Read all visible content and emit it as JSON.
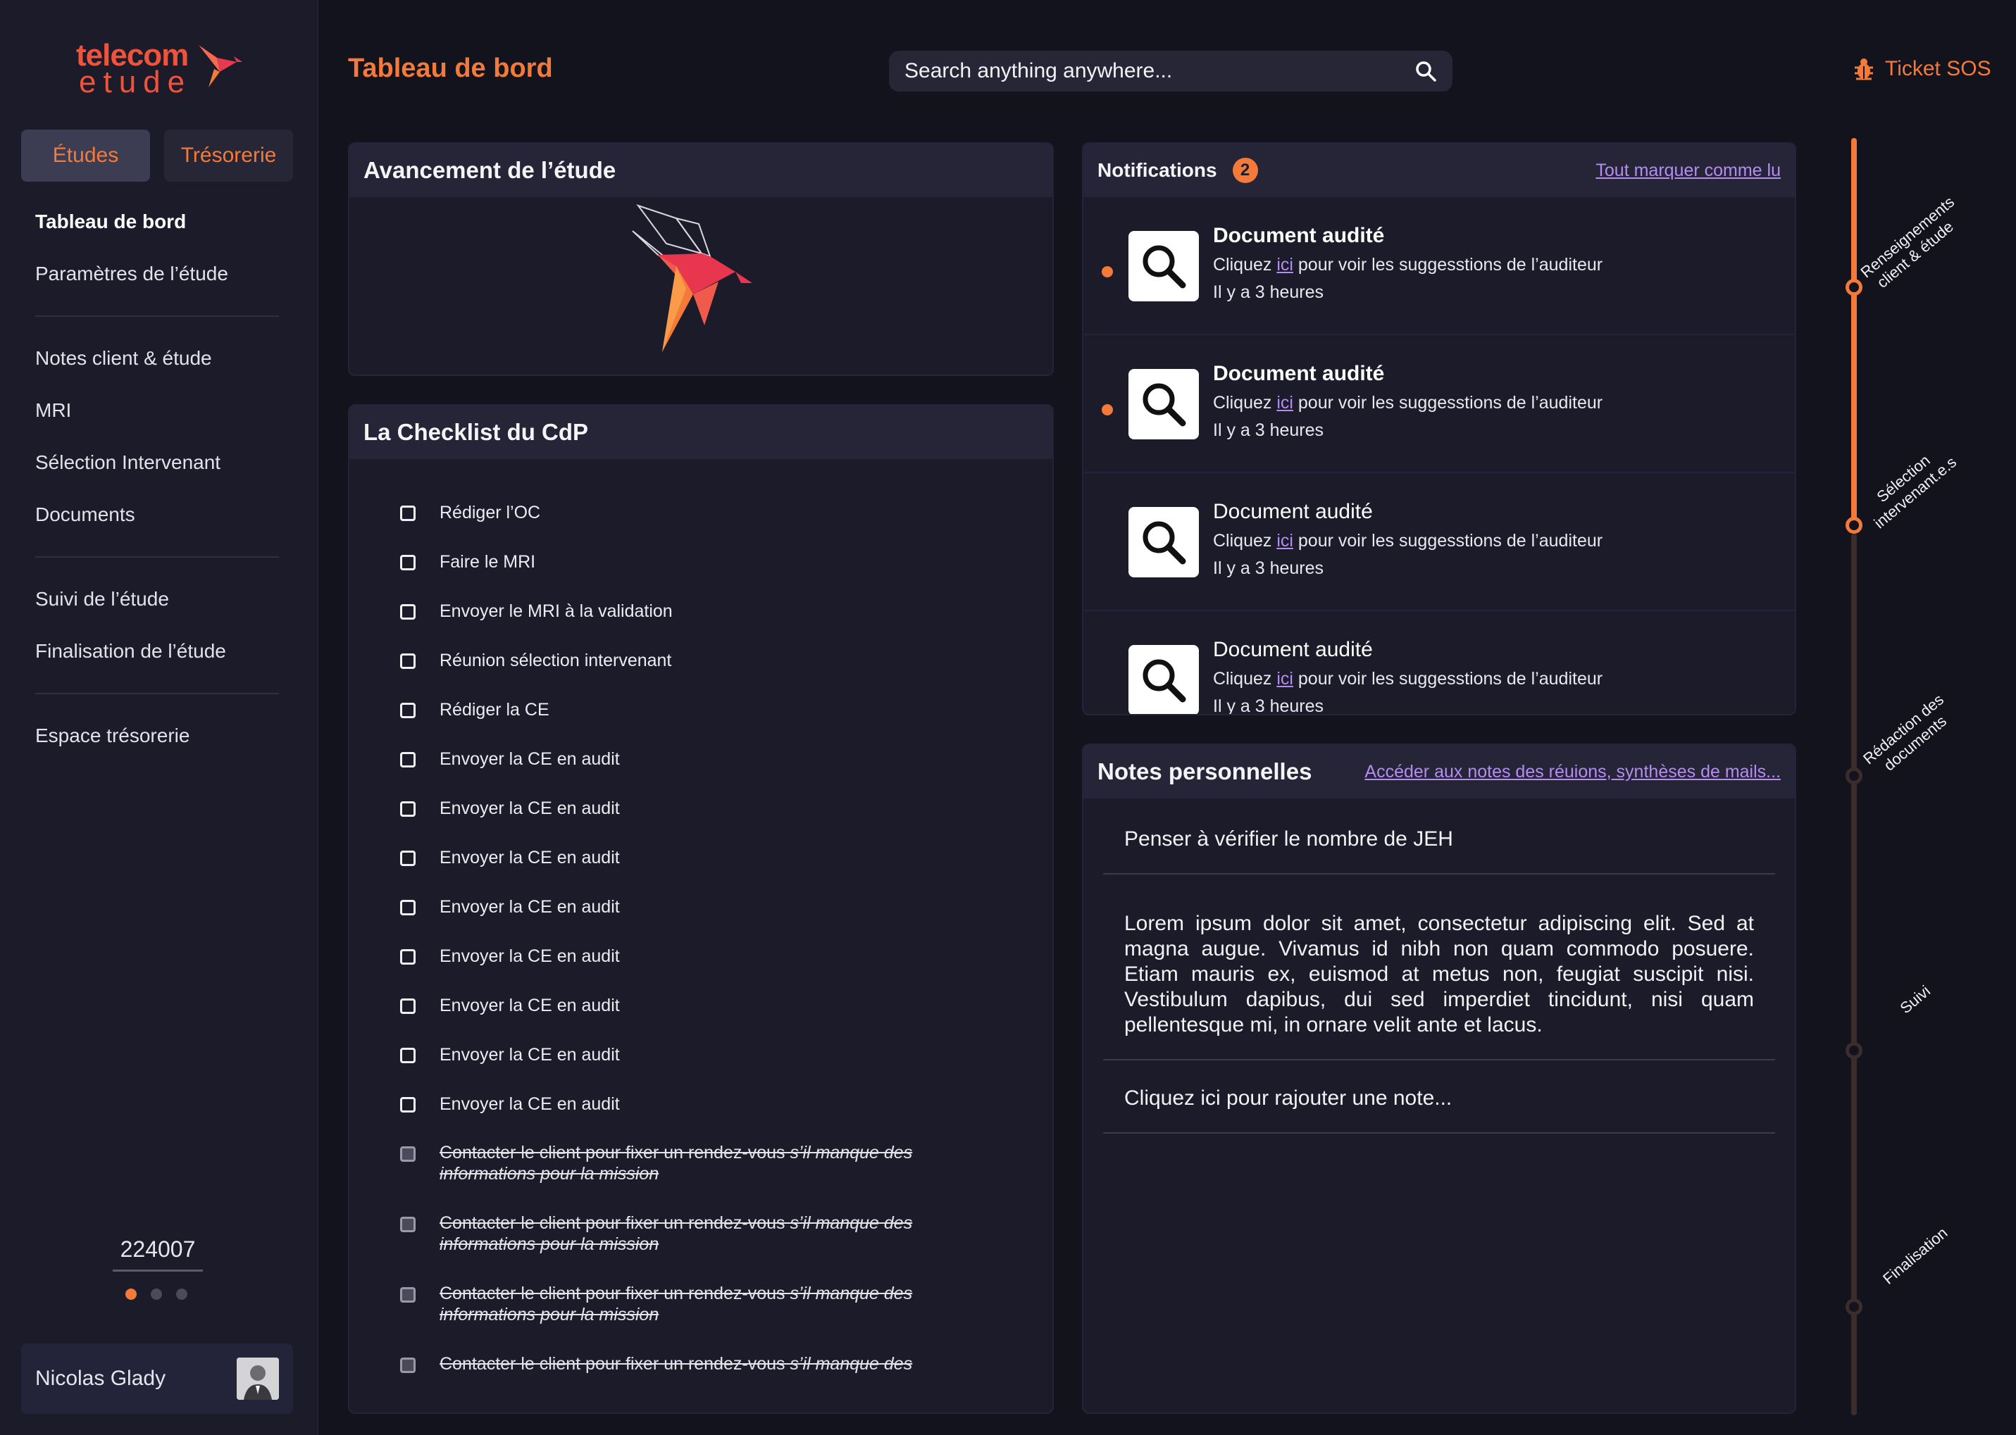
{
  "app": {
    "logo_top": "telecom",
    "logo_bottom": "etude",
    "brand_color": "#f47a3a"
  },
  "sidebar": {
    "tabs": [
      {
        "label": "Études",
        "active": true
      },
      {
        "label": "Trésorerie",
        "active": false
      }
    ],
    "nav_groups": [
      [
        "Tableau de bord",
        "Paramètres de l’étude"
      ],
      [
        "Notes client & étude",
        "MRI",
        "Sélection Intervenant",
        "Documents"
      ],
      [
        "Suivi de l’étude",
        "Finalisation de l’étude"
      ],
      [
        "Espace trésorerie"
      ]
    ],
    "active_item": "Tableau de bord",
    "study_number": "224007",
    "pager": {
      "count": 3,
      "active": 0
    },
    "user": {
      "name": "Nicolas Glady"
    }
  },
  "header": {
    "title": "Tableau de bord",
    "search_placeholder": "Search anything anywhere...",
    "ticket_label": "Ticket SOS"
  },
  "progress": {
    "title": "Avancement de l’étude"
  },
  "checklist": {
    "title": "La Checklist du CdP",
    "items": [
      "Rédiger l’OC",
      "Faire le MRI",
      "Envoyer le MRI à la validation",
      "Réunion sélection intervenant",
      "Rédiger la CE",
      "Envoyer la CE en audit",
      "Envoyer la CE en audit",
      "Envoyer la CE en audit",
      "Envoyer la CE en audit",
      "Envoyer la CE en audit",
      "Envoyer la CE en audit",
      "Envoyer la CE en audit",
      "Envoyer la CE en audit"
    ],
    "done_items": [
      {
        "text": "Contacter le client pour fixer un rendez-vous",
        "italic": "s’il manque des informations pour la mission"
      },
      {
        "text": "Contacter le client pour fixer un rendez-vous",
        "italic": "s’il manque des informations pour la mission"
      },
      {
        "text": "Contacter le client pour fixer un rendez-vous",
        "italic": "s’il manque des informations pour la mission"
      },
      {
        "text": "Contacter le client pour fixer un rendez-vous",
        "italic": "s’il manque des"
      }
    ]
  },
  "notifications": {
    "title": "Notifications",
    "count": "2",
    "mark_all": "Tout marquer comme lu",
    "items": [
      {
        "title": "Document audité",
        "pre": "Cliquez",
        "link": "ici",
        "post": "pour voir les suggesstions de l’auditeur",
        "time": "Il y a 3 heures",
        "unread": true
      },
      {
        "title": "Document audité",
        "pre": "Cliquez",
        "link": "ici",
        "post": "pour voir les suggesstions de l’auditeur",
        "time": "Il y a 3 heures",
        "unread": true
      },
      {
        "title": "Document audité",
        "pre": "Cliquez",
        "link": "ici",
        "post": "pour voir les suggesstions de l’auditeur",
        "time": "Il y a 3 heures",
        "unread": false
      },
      {
        "title": "Document audité",
        "pre": "Cliquez",
        "link": "ici",
        "post": "pour voir les suggesstions de l’auditeur",
        "time": "Il y a 3 heures",
        "unread": false
      }
    ]
  },
  "notes": {
    "title": "Notes personnelles",
    "link": "Accéder aux notes des réuions, synthèses de mails...",
    "items": [
      "Penser à vérifier le nombre de JEH",
      "Lorem ipsum dolor sit amet, consectetur adipiscing elit. Sed at magna augue. Vivamus id nibh non quam commodo posuere. Etiam mauris ex, euismod at metus non, feugiat suscipit nisi. Vestibulum dapibus, dui sed imperdiet tincidunt, nisi quam pellentesque mi, in ornare velit ante et lacus."
    ],
    "add_placeholder": "Cliquez ici pour rajouter une note..."
  },
  "timeline": {
    "steps": [
      {
        "label": "Renseignements client & étude",
        "done": true
      },
      {
        "label": "Sélection intervenant.e.s",
        "done": true
      },
      {
        "label": "Rédaction des documents",
        "done": false
      },
      {
        "label": "Suivi",
        "done": false
      },
      {
        "label": "Finalisation",
        "done": false
      }
    ]
  }
}
